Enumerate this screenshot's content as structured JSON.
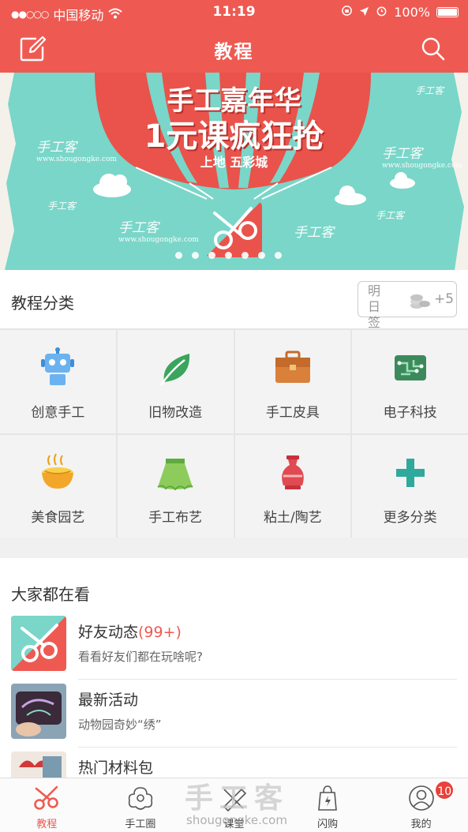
{
  "status": {
    "carrier": "中国移动",
    "time": "11:19",
    "battery": "100%"
  },
  "header": {
    "title": "教程",
    "edit_icon": "edit-icon",
    "search_icon": "search-icon"
  },
  "banner": {
    "headline": "手工嘉年华",
    "promo": "1元课疯狂抢",
    "sub": "上地 五彩城",
    "watermark_logo": "手工客",
    "watermark_url": "www.shougongke.com",
    "slide_count": 7
  },
  "categories": {
    "title": "教程分类",
    "checkin": {
      "line1": "明日",
      "line2": "签到",
      "reward": "+5"
    },
    "items": [
      {
        "label": "创意手工",
        "icon": "robot-icon"
      },
      {
        "label": "旧物改造",
        "icon": "leaf-icon"
      },
      {
        "label": "手工皮具",
        "icon": "briefcase-icon"
      },
      {
        "label": "电子科技",
        "icon": "circuit-icon"
      },
      {
        "label": "美食园艺",
        "icon": "noodle-bowl-icon"
      },
      {
        "label": "手工布艺",
        "icon": "skirt-icon"
      },
      {
        "label": "粘土/陶艺",
        "icon": "vase-icon"
      },
      {
        "label": "更多分类",
        "icon": "plus-icon"
      }
    ]
  },
  "popular": {
    "title": "大家都在看",
    "items": [
      {
        "title": "好友动态",
        "count": "(99+)",
        "desc": "看看好友们都在玩啥呢?"
      },
      {
        "title": "最新活动",
        "desc": "动物园奇妙“绣”"
      },
      {
        "title": "热门材料包",
        "desc": ""
      }
    ]
  },
  "tabs": [
    {
      "label": "教程",
      "icon": "scissors-icon",
      "active": true
    },
    {
      "label": "手工圈",
      "icon": "flower-icon"
    },
    {
      "label": "课堂",
      "icon": "ruler-icon"
    },
    {
      "label": "闪购",
      "icon": "shopping-bag-icon"
    },
    {
      "label": "我的",
      "icon": "profile-icon",
      "badge": "10"
    }
  ],
  "watermark": {
    "big": "手工客",
    "small": "shougongke.com"
  },
  "colors": {
    "brand": "#ee5a52",
    "banner_bg": "#7ad6c9"
  }
}
